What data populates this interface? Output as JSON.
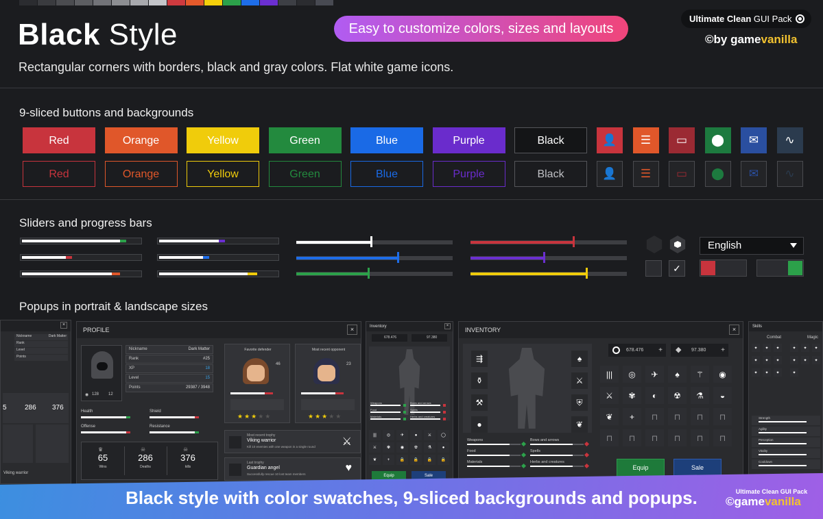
{
  "swatches": [
    "#2b2c30",
    "#3a3b3f",
    "#4b4c50",
    "#5d5e62",
    "#727378",
    "#8d8e92",
    "#a8a9ad",
    "#c4c5c9",
    "#cf3a3f",
    "#e55a2b",
    "#f5d00b",
    "#2ca14a",
    "#1e6de8",
    "#6b2fd1",
    "#3d3f45",
    "#2b2c30",
    "#484a52"
  ],
  "header": {
    "title_bold": "Black",
    "title_rest": " Style",
    "subtitle": "Rectangular corners with borders, black and gray colors. Flat white game icons.",
    "pill": "Easy to customize colors, sizes and layouts",
    "brand_bold": "Ultimate Clean",
    "brand_rest": " GUI Pack",
    "byline_pre": "©by game",
    "byline_acc": "vanilla"
  },
  "sections": {
    "buttons": "9-sliced buttons and backgrounds",
    "sliders": "Sliders and progress bars",
    "popups": "Popups in portrait & landscape sizes"
  },
  "buttons": [
    {
      "label": "Red",
      "color": "#c8343d"
    },
    {
      "label": "Orange",
      "color": "#e0572a"
    },
    {
      "label": "Yellow",
      "color": "#f0cc0b"
    },
    {
      "label": "Green",
      "color": "#238a3e"
    },
    {
      "label": "Blue",
      "color": "#1a6ae6"
    },
    {
      "label": "Purple",
      "color": "#6a2ccc"
    },
    {
      "label": "Black",
      "color": "#141517"
    }
  ],
  "icon_buttons": [
    {
      "icon": "user-icon",
      "color": "#c8343d"
    },
    {
      "icon": "list-icon",
      "color": "#e0572a"
    },
    {
      "icon": "chest-icon",
      "color": "#9b2a33"
    },
    {
      "icon": "map-pin-icon",
      "color": "#1d7a3f"
    },
    {
      "icon": "mail-icon",
      "color": "#2a4fa0"
    },
    {
      "icon": "graph-icon",
      "color": "#2b3b4e"
    }
  ],
  "progress_bars": [
    {
      "value": 0.87,
      "accent": "#2ca14a",
      "accent_len": 0.05
    },
    {
      "value": 0.55,
      "accent": "#6b2fd1",
      "accent_len": 0.05
    },
    {
      "value": 0.42,
      "accent": "#c8343d",
      "accent_len": 0.05
    },
    {
      "value": 0.42,
      "accent": "#1e6de8",
      "accent_len": 0.05
    },
    {
      "value": 0.82,
      "accent": "#e0572a",
      "accent_len": 0.07
    },
    {
      "value": 0.82,
      "accent": "#f0cc0b",
      "accent_len": 0.08
    }
  ],
  "sliders": [
    {
      "value": 0.48,
      "color": "#ffffff"
    },
    {
      "value": 0.66,
      "color": "#c8343d"
    },
    {
      "value": 0.65,
      "color": "#1e6de8"
    },
    {
      "value": 0.47,
      "color": "#6b2fd1"
    },
    {
      "value": 0.46,
      "color": "#2ca14a"
    },
    {
      "value": 0.74,
      "color": "#f0cc0b"
    }
  ],
  "dropdown": {
    "value": "English"
  },
  "profile": {
    "title": "PROFILE",
    "close": "×",
    "fields": [
      {
        "label": "Nickname",
        "value": "Dark Matter"
      },
      {
        "label": "Rank",
        "value": "#25"
      },
      {
        "label": "XP",
        "value": "18"
      },
      {
        "label": "Level",
        "value": "15"
      },
      {
        "label": "Points",
        "value": "29387 / 3948"
      }
    ],
    "small_stats": [
      "128",
      "12"
    ],
    "meters": [
      "Health",
      "Shield",
      "Offense",
      "Resistance"
    ],
    "stats": [
      {
        "value": "65",
        "label": "Wins"
      },
      {
        "value": "286",
        "label": "Deaths"
      },
      {
        "value": "376",
        "label": "kills"
      }
    ]
  },
  "defenders": [
    {
      "title": "Favorite defender",
      "count": "46"
    },
    {
      "title": "Most recent opponent",
      "count": "23"
    }
  ],
  "achievements": [
    {
      "caption": "Most recent trophy",
      "title": "Viking warrior",
      "desc": "Kill 10 enemies with one weapon in a single round"
    },
    {
      "caption": "Last trophy",
      "title": "Guardian angel",
      "desc": "Successfully rescue 10 lost team members"
    }
  ],
  "inventory_small": {
    "title": "Inventory",
    "close": "×",
    "coins": "678.476",
    "gems": "97.380",
    "equip": "Equip",
    "sale": "Sale",
    "stats": [
      "Weapons",
      "Bows and arrows",
      "Food",
      "Spells",
      "Materials",
      "Herbs and creatures"
    ]
  },
  "inventory_large": {
    "title": "INVENTORY",
    "close": "×",
    "coins": "678.476",
    "gems": "97.380",
    "equip": "Equip",
    "sale": "Sale",
    "stats": [
      "Weapons",
      "Bows and arrows",
      "Food",
      "Spells",
      "Materials",
      "Herbs and creatures"
    ]
  },
  "skills": {
    "title": "Skills",
    "tabs": [
      "Combat",
      "Magic"
    ],
    "stats": [
      "Strength",
      "Agility",
      "Perception",
      "Vitality",
      "Cooldown"
    ]
  },
  "left_cut": {
    "fields": [
      "Nickname",
      "Rank",
      "Level",
      "Points"
    ],
    "value": "Dark Matter",
    "stats": [
      "5",
      "286",
      "376"
    ],
    "trophy": "Viking warrior"
  },
  "banner": {
    "text": "Black style with color swatches, 9-sliced backgrounds and popups.",
    "logo_top": "Ultimate Clean GUI Pack",
    "logo_pre": "©game",
    "logo_acc": "vanilla"
  }
}
